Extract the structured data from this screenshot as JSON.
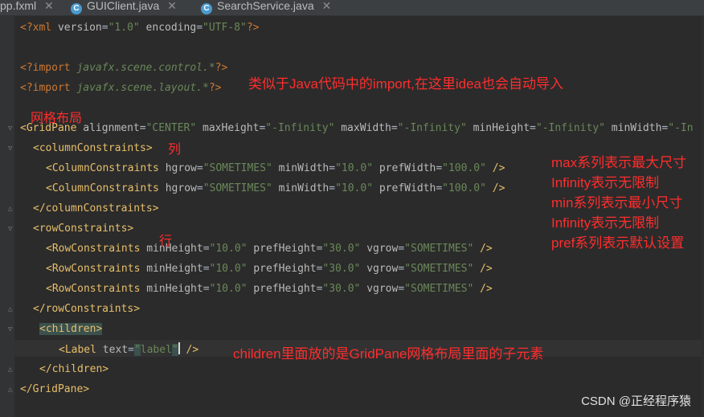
{
  "tabs": [
    {
      "label": "pp.fxml",
      "icon": "fxml-file-icon"
    },
    {
      "label": "GUIClient.java",
      "icon": "java-class-icon"
    },
    {
      "label": "SearchService.java",
      "icon": "java-class-icon"
    }
  ],
  "code": {
    "l1": {
      "pi_open": "<?xml ",
      "a1": "version",
      "eq1": "=",
      "v1": "\"1.0\"",
      "a2": " encoding",
      "eq2": "=",
      "v2": "\"UTF-8\"",
      "pi_close": "?>"
    },
    "l2": {
      "pi_open": "<?import ",
      "pkg": "javafx.scene.control.*",
      "pi_close": "?>"
    },
    "l3": {
      "pi_open": "<?import ",
      "pkg": "javafx.scene.layout.*",
      "pi_close": "?>"
    },
    "l4": {
      "open": "<GridPane ",
      "a1": "alignment",
      "v1": "\"CENTER\"",
      "a2": " maxHeight",
      "v2": "\"-Infinity\"",
      "a3": " maxWidth",
      "v3": "\"-Infinity\"",
      "a4": " minHeight",
      "v4": "\"-Infinity\"",
      "a5": " minWidth",
      "v5": "\"-In"
    },
    "l5": {
      "tag": "<columnConstraints>"
    },
    "l6": {
      "open": "<ColumnConstraints ",
      "a1": "hgrow",
      "v1": "\"SOMETIMES\"",
      "a2": " minWidth",
      "v2": "\"10.0\"",
      "a3": " prefWidth",
      "v3": "\"100.0\"",
      "close": " />"
    },
    "l7": {
      "open": "<ColumnConstraints ",
      "a1": "hgrow",
      "v1": "\"SOMETIMES\"",
      "a2": " minWidth",
      "v2": "\"10.0\"",
      "a3": " prefWidth",
      "v3": "\"100.0\"",
      "close": " />"
    },
    "l8": {
      "tag": "</columnConstraints>"
    },
    "l9": {
      "tag": "<rowConstraints>"
    },
    "l10": {
      "open": "<RowConstraints ",
      "a1": "minHeight",
      "v1": "\"10.0\"",
      "a2": " prefHeight",
      "v2": "\"30.0\"",
      "a3": " vgrow",
      "v3": "\"SOMETIMES\"",
      "close": " />"
    },
    "l11": {
      "open": "<RowConstraints ",
      "a1": "minHeight",
      "v1": "\"10.0\"",
      "a2": " prefHeight",
      "v2": "\"30.0\"",
      "a3": " vgrow",
      "v3": "\"SOMETIMES\"",
      "close": " />"
    },
    "l12": {
      "open": "<RowConstraints ",
      "a1": "minHeight",
      "v1": "\"10.0\"",
      "a2": " prefHeight",
      "v2": "\"30.0\"",
      "a3": " vgrow",
      "v3": "\"SOMETIMES\"",
      "close": " />"
    },
    "l13": {
      "tag": "</rowConstraints>"
    },
    "l14": {
      "tag": "<children>"
    },
    "l15": {
      "open": "<Label ",
      "a1": "text",
      "eq": "=",
      "q1": "\"",
      "v1": "label",
      "q2": "\"",
      "close": " />"
    },
    "l16": {
      "tag": "</children>"
    },
    "l17": {
      "tag": "</GridPane>"
    }
  },
  "annotations": {
    "import_note": "类似于Java代码中的import,在这里idea也会自动导入",
    "grid_note": "网格布局",
    "column_note": "列",
    "row_note": "行",
    "size_notes": [
      "max系列表示最大尺寸",
      "Infinity表示无限制",
      "min系列表示最小尺寸",
      "Infinity表示无限制",
      "pref系列表示默认设置"
    ],
    "children_note": "children里面放的是GridPane网格布局里面的子元素"
  },
  "watermark": "CSDN @正经程序猿",
  "colors": {
    "tag": "#e8bf6a",
    "value": "#6a8759",
    "processing": "#cc7832",
    "annotation": "#ff2d2d"
  }
}
